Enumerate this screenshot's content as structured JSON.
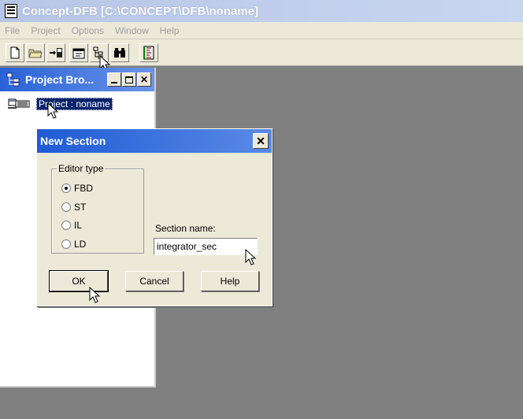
{
  "window": {
    "title": "Concept-DFB [C:\\CONCEPT\\DFB\\noname]"
  },
  "menubar": {
    "items": [
      "File",
      "Project",
      "Options",
      "Window",
      "Help"
    ]
  },
  "toolbar": {
    "buttons": [
      "new-file-icon",
      "open-folder-icon",
      "import-icon",
      "properties-icon",
      "project-browser-icon",
      "find-icon",
      "ruler-icon"
    ]
  },
  "project_browser": {
    "title": "Project Bro...",
    "tree_root_label": "Project : noname"
  },
  "dialog": {
    "title": "New Section",
    "editor_type_label": "Editor type",
    "editor_types": [
      {
        "label": "FBD",
        "selected": true
      },
      {
        "label": "ST",
        "selected": false
      },
      {
        "label": "IL",
        "selected": false
      },
      {
        "label": "LD",
        "selected": false
      }
    ],
    "section_name_label": "Section name:",
    "section_name_value": "integrator_sec",
    "ok_label": "OK",
    "cancel_label": "Cancel",
    "help_label": "Help"
  },
  "colors": {
    "title_gradient_start": "#2962d6",
    "desktop": "#808080",
    "dialog_face": "#ece9d8",
    "selection": "#0a246a"
  }
}
